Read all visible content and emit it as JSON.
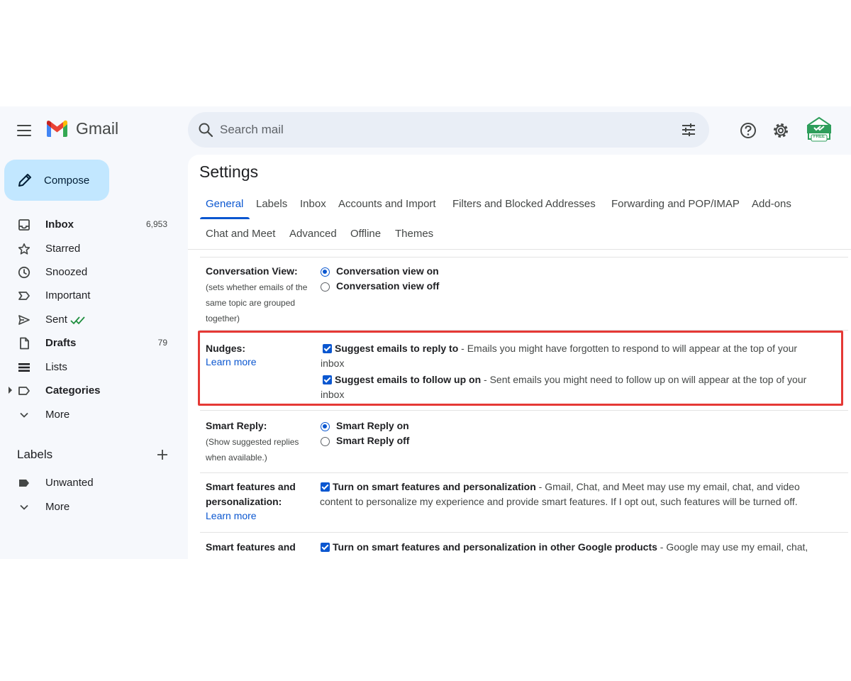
{
  "app": {
    "name": "Gmail"
  },
  "header": {
    "search_placeholder": "Search mail",
    "avatar_badge": "FREE"
  },
  "sidebar": {
    "compose_label": "Compose",
    "items": [
      {
        "label": "Inbox",
        "count": "6,953",
        "bold": true
      },
      {
        "label": "Starred",
        "count": ""
      },
      {
        "label": "Snoozed",
        "count": ""
      },
      {
        "label": "Important",
        "count": ""
      },
      {
        "label": "Sent",
        "count": ""
      },
      {
        "label": "Drafts",
        "count": "79",
        "bold": true
      },
      {
        "label": "Lists",
        "count": ""
      },
      {
        "label": "Categories",
        "count": "",
        "bold": true
      },
      {
        "label": "More",
        "count": ""
      }
    ],
    "labels_header": "Labels",
    "labels": [
      {
        "label": "Unwanted"
      },
      {
        "label": "More"
      }
    ]
  },
  "settings": {
    "title": "Settings",
    "tabs": [
      "General",
      "Labels",
      "Inbox",
      "Accounts and Import",
      "Filters and Blocked Addresses",
      "Forwarding and POP/IMAP",
      "Add-ons",
      "Chat and Meet",
      "Advanced",
      "Offline",
      "Themes"
    ],
    "active_tab": "General",
    "sections": {
      "conversation_view": {
        "label": "Conversation View:",
        "desc_lines": [
          "(sets whether emails of the",
          "same topic are grouped",
          "together)"
        ],
        "options": [
          "Conversation view on",
          "Conversation view off"
        ],
        "selected": "Conversation view on"
      },
      "nudges": {
        "label": "Nudges:",
        "link": "Learn more",
        "items": [
          {
            "title": "Suggest emails to reply to",
            "line1": " - Emails you might have forgotten to respond to will appear at the top of your",
            "line2": "inbox",
            "checked": true
          },
          {
            "title": "Suggest emails to follow up on",
            "line1": " - Sent emails you might need to follow up on will appear at the top of your",
            "line2": "inbox",
            "checked": true
          }
        ]
      },
      "smart_reply": {
        "label": "Smart Reply:",
        "desc_lines": [
          "(Show suggested replies",
          "when available.)"
        ],
        "options": [
          "Smart Reply on",
          "Smart Reply off"
        ],
        "selected": "Smart Reply on"
      },
      "smart_features": {
        "label_lines": [
          "Smart features and",
          "personalization:"
        ],
        "link": "Learn more",
        "title": "Turn on smart features and personalization",
        "line1": " - Gmail, Chat, and Meet may use my email, chat, and video",
        "line2": "content to personalize my experience and provide smart features. If I opt out, such features will be turned off.",
        "checked": true
      },
      "smart_features_other": {
        "label": "Smart features and",
        "title": "Turn on smart features and personalization in other Google products",
        "line1": " - Google may use my email, chat,",
        "checked": true
      }
    }
  },
  "colors": {
    "accent": "#0b57d0",
    "compose_bg": "#c2e7ff",
    "highlight": "#e53935",
    "sent_check": "#1e8e3e"
  }
}
